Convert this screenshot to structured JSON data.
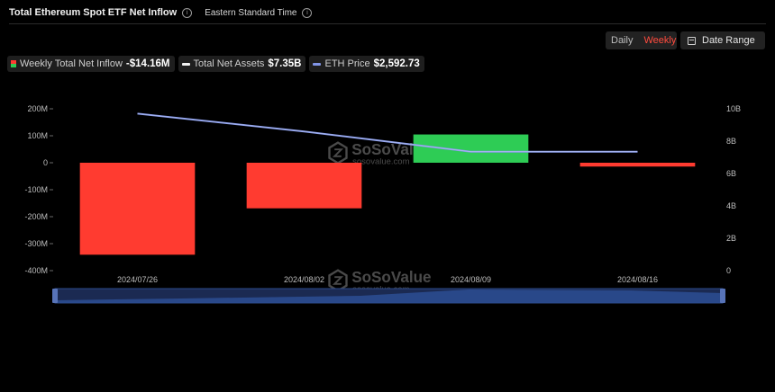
{
  "header": {
    "title": "Total Ethereum Spot ETF Net Inflow",
    "timezone": "Eastern Standard Time"
  },
  "controls": {
    "daily_label": "Daily",
    "weekly_label": "Weekly",
    "date_range_label": "Date Range",
    "active_period": "Weekly"
  },
  "legend": [
    {
      "label": "Weekly Total Net Inflow",
      "value": "-$14.16M",
      "icon": "bar-swatch-red-green"
    },
    {
      "label": "Total Net Assets",
      "value": "$7.35B",
      "icon": "line-swatch-white"
    },
    {
      "label": "ETH Price",
      "value": "$2,592.73",
      "icon": "line-swatch-blue"
    }
  ],
  "watermark": {
    "brand": "SoSoValue",
    "url": "sosovalue.com"
  },
  "colors": {
    "positive": "#2ecc55",
    "negative": "#ff3b30",
    "line": "#8296e8",
    "accent": "#ff4b3e"
  },
  "chart_data": {
    "type": "bar",
    "categories": [
      "2024/07/26",
      "2024/08/02",
      "2024/08/09",
      "2024/08/16"
    ],
    "series": [
      {
        "name": "Weekly Total Net Inflow",
        "type": "bar",
        "axis": "left",
        "values": [
          -341,
          -169,
          104.8,
          -14.16
        ]
      },
      {
        "name": "Total Net Assets",
        "type": "line",
        "axis": "right",
        "values": [
          9.7,
          8.6,
          7.35,
          7.35
        ]
      }
    ],
    "left_axis": {
      "ylim": [
        -400,
        200
      ],
      "ticks": [
        200,
        100,
        0,
        -100,
        -200,
        -300,
        -400
      ],
      "tick_labels": [
        "200M",
        "100M",
        "0",
        "-100M",
        "-200M",
        "-300M",
        "-400M"
      ]
    },
    "right_axis": {
      "ylim": [
        0,
        10
      ],
      "ticks": [
        10,
        8,
        6,
        4,
        2,
        0
      ],
      "tick_labels": [
        "10B",
        "8B",
        "6B",
        "4B",
        "2B",
        "0"
      ]
    },
    "grid": false,
    "legend_position": "top-left"
  }
}
